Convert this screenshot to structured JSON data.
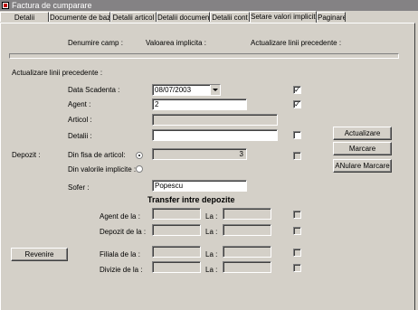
{
  "window": {
    "title": "Factura de cumparare"
  },
  "tabs": [
    {
      "label": "Detalii"
    },
    {
      "label": "Documente de baza"
    },
    {
      "label": "Detalii articol"
    },
    {
      "label": "Detalii document"
    },
    {
      "label": "Detalii cont"
    },
    {
      "label": "Setare valori implicite"
    },
    {
      "label": "Paginare"
    }
  ],
  "headers": {
    "denumire": "Denumire camp :",
    "valoare": "Valoarea implicita :",
    "actualizare": "Actualizare linii precedente :"
  },
  "section": {
    "actualizare": "Actualizare linii precedente :"
  },
  "fields": {
    "data_scadenta": {
      "label": "Data Scadenta :",
      "value": "08/07/2003"
    },
    "agent": {
      "label": "Agent :",
      "value": "2"
    },
    "articol": {
      "label": "Articol :",
      "value": ""
    },
    "detalii": {
      "label": "Detalii :",
      "value": ""
    }
  },
  "depozit": {
    "label": "Depozit :",
    "option1": "Din fisa de articol:",
    "option2": "Din valorile implicite :",
    "value": "3"
  },
  "sofer": {
    "label": "Sofer :",
    "value": "Popescu"
  },
  "transfer": {
    "title": "Transfer intre depozite",
    "agent_label": "Agent de la :",
    "depozit_label": "Depozit de la :",
    "filiala_label": "Filiala de la :",
    "divizie_label": "Divizie de la :",
    "la": "La :"
  },
  "buttons": {
    "actualizare": "Actualizare",
    "marcare": "Marcare",
    "anulare_marcare": "ANulare Marcare",
    "revenire": "Revenire"
  },
  "checks": {
    "data_scadenta": "✓",
    "agent": "✓"
  }
}
